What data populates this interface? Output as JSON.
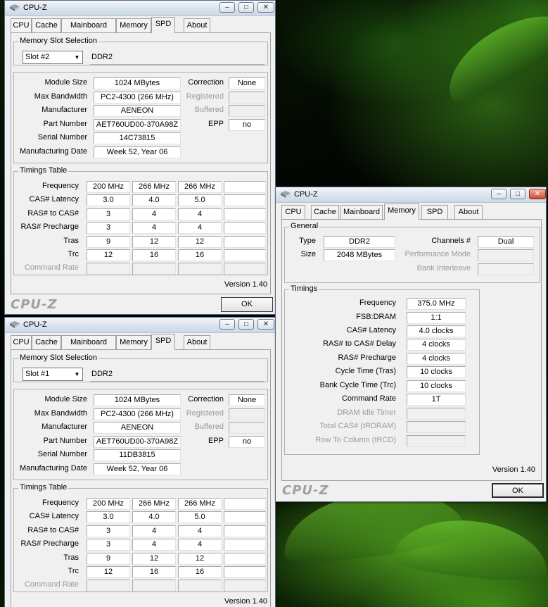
{
  "app_title": "CPU-Z",
  "tabs": [
    "CPU",
    "Cache",
    "Mainboard",
    "Memory",
    "SPD",
    "About"
  ],
  "spd_labels": {
    "group_slot": "Memory Slot Selection",
    "module_size": "Module Size",
    "max_bandwidth": "Max Bandwidth",
    "manufacturer": "Manufacturer",
    "part_number": "Part Number",
    "serial_number": "Serial Number",
    "manufacturing_date": "Manufacturing Date",
    "correction": "Correction",
    "registered": "Registered",
    "buffered": "Buffered",
    "epp": "EPP",
    "group_timings": "Timings Table",
    "frequency": "Frequency",
    "cas_latency": "CAS# Latency",
    "ras_to_cas": "RAS# to CAS#",
    "ras_precharge": "RAS# Precharge",
    "tras": "Tras",
    "trc": "Trc",
    "command_rate": "Command Rate"
  },
  "spd_windows": [
    {
      "slot": "Slot #2",
      "type": "DDR2",
      "module_size": "1024 MBytes",
      "max_bandwidth": "PC2-4300 (266 MHz)",
      "manufacturer": "AENEON",
      "part_number": "AET760UD00-370A98Z",
      "serial_number": "14C73815",
      "manufacturing_date": "Week 52, Year 06",
      "correction": "None",
      "registered": "",
      "buffered": "",
      "epp": "no",
      "timings": {
        "frequency": [
          "200 MHz",
          "266 MHz",
          "266 MHz",
          ""
        ],
        "cas_latency": [
          "3.0",
          "4.0",
          "5.0",
          ""
        ],
        "ras_to_cas": [
          "3",
          "4",
          "4",
          ""
        ],
        "ras_precharge": [
          "3",
          "4",
          "4",
          ""
        ],
        "tras": [
          "9",
          "12",
          "12",
          ""
        ],
        "trc": [
          "12",
          "16",
          "16",
          ""
        ],
        "command_rate": [
          "",
          "",
          "",
          ""
        ]
      },
      "version": "Version 1.40",
      "brand": "CPU-Z",
      "ok_label": "OK"
    },
    {
      "slot": "Slot #1",
      "type": "DDR2",
      "module_size": "1024 MBytes",
      "max_bandwidth": "PC2-4300 (266 MHz)",
      "manufacturer": "AENEON",
      "part_number": "AET760UD00-370A98Z",
      "serial_number": "11DB3815",
      "manufacturing_date": "Week 52, Year 06",
      "correction": "None",
      "registered": "",
      "buffered": "",
      "epp": "no",
      "timings": {
        "frequency": [
          "200 MHz",
          "266 MHz",
          "266 MHz",
          ""
        ],
        "cas_latency": [
          "3.0",
          "4.0",
          "5.0",
          ""
        ],
        "ras_to_cas": [
          "3",
          "4",
          "4",
          ""
        ],
        "ras_precharge": [
          "3",
          "4",
          "4",
          ""
        ],
        "tras": [
          "9",
          "12",
          "12",
          ""
        ],
        "trc": [
          "12",
          "16",
          "16",
          ""
        ],
        "command_rate": [
          "",
          "",
          "",
          ""
        ]
      },
      "version": "Version 1.40"
    }
  ],
  "memory_window": {
    "general_title": "General",
    "type_label": "Type",
    "type": "DDR2",
    "size_label": "Size",
    "size": "2048 MBytes",
    "channels_label": "Channels #",
    "channels": "Dual",
    "perf_mode_label": "Performance Mode",
    "perf_mode": "",
    "bank_interleave_label": "Bank Interleave",
    "bank_interleave": "",
    "timings_title": "Timings",
    "rows": [
      {
        "label": "Frequency",
        "value": "375.0 MHz",
        "dim": false
      },
      {
        "label": "FSB:DRAM",
        "value": "1:1",
        "dim": false
      },
      {
        "label": "CAS# Latency",
        "value": "4.0 clocks",
        "dim": false
      },
      {
        "label": "RAS# to CAS# Delay",
        "value": "4 clocks",
        "dim": false
      },
      {
        "label": "RAS# Precharge",
        "value": "4 clocks",
        "dim": false
      },
      {
        "label": "Cycle Time (Tras)",
        "value": "10 clocks",
        "dim": false
      },
      {
        "label": "Bank Cycle Time (Trc)",
        "value": "10 clocks",
        "dim": false
      },
      {
        "label": "Command Rate",
        "value": "1T",
        "dim": false
      },
      {
        "label": "DRAM Idle Timer",
        "value": "",
        "dim": true
      },
      {
        "label": "Total CAS# (tRDRAM)",
        "value": "",
        "dim": true
      },
      {
        "label": "Row To Column (tRCD)",
        "value": "",
        "dim": true
      }
    ],
    "version": "Version 1.40",
    "brand": "CPU-Z",
    "ok_label": "OK"
  },
  "title_buttons": {
    "minimize": "–",
    "maximize": "□",
    "close": "✕"
  }
}
